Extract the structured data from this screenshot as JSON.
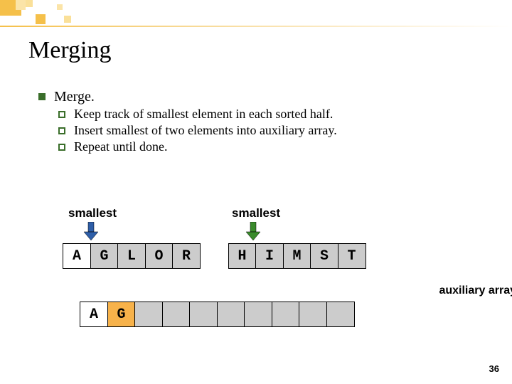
{
  "title": "Merging",
  "merge": {
    "heading": "Merge.",
    "points": [
      "Keep track of smallest element in each sorted half.",
      "Insert smallest of two elements into auxiliary array.",
      "Repeat until done."
    ]
  },
  "labels": {
    "smallest_left": "smallest",
    "smallest_right": "smallest",
    "arrow_left_color": "#2e5ea8",
    "arrow_right_color": "#3a8a2c",
    "aux": "auxiliary array"
  },
  "left_array": [
    "A",
    "G",
    "L",
    "O",
    "R"
  ],
  "right_array": [
    "H",
    "I",
    "M",
    "S",
    "T"
  ],
  "aux_array": [
    "A",
    "G",
    "",
    "",
    "",
    "",
    "",
    "",
    "",
    ""
  ],
  "aux_highlight_index": 1,
  "page_number": "36"
}
